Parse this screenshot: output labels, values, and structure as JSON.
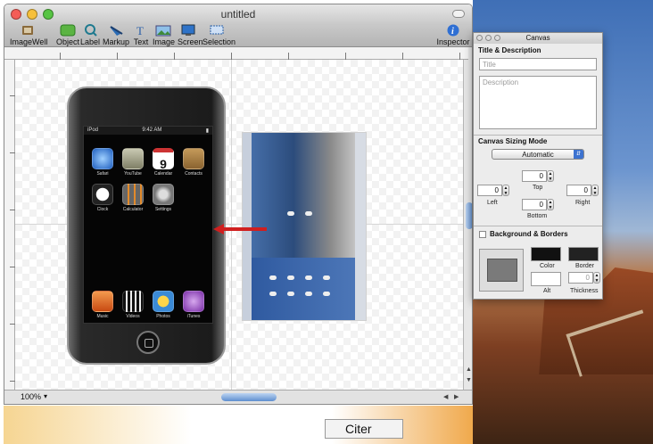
{
  "window": {
    "title": "untitled"
  },
  "toolbar": {
    "items": [
      {
        "label": "ImageWell",
        "icon": "imagewell-icon"
      },
      {
        "label": "Object",
        "icon": "object-icon"
      },
      {
        "label": "Label",
        "icon": "label-icon"
      },
      {
        "label": "Markup",
        "icon": "markup-icon"
      },
      {
        "label": "Text",
        "icon": "text-icon"
      },
      {
        "label": "Image",
        "icon": "image-icon"
      },
      {
        "label": "Screen",
        "icon": "screen-icon"
      },
      {
        "label": "Selection",
        "icon": "selection-icon"
      }
    ],
    "inspector": {
      "label": "Inspector",
      "icon": "info-icon"
    }
  },
  "ipod": {
    "carrier": "iPod",
    "time": "9:42 AM",
    "apps": [
      {
        "label": "Safari",
        "color": "#3b88e0"
      },
      {
        "label": "YouTube",
        "color": "#b9b9a0"
      },
      {
        "label": "Calendar",
        "color": "#ffffff",
        "date": "9"
      },
      {
        "label": "Contacts",
        "color": "#a27a43"
      },
      {
        "label": "Clock",
        "color": "#222222"
      },
      {
        "label": "Calculator",
        "color": "#555555"
      },
      {
        "label": "Settings",
        "color": "#8c8c8c"
      }
    ],
    "dock": [
      {
        "label": "Music",
        "color": "#e46b2b"
      },
      {
        "label": "Videos",
        "color": "#2b2b2b"
      },
      {
        "label": "Photos",
        "color": "#e6b52a"
      },
      {
        "label": "iTunes",
        "color": "#9b54c2"
      }
    ]
  },
  "status": {
    "zoom": "100%"
  },
  "below": {
    "citer_label": "Citer"
  },
  "panel": {
    "title": "Canvas",
    "title_section": "Title & Description",
    "title_placeholder": "Title",
    "description_placeholder": "Description",
    "sizing_section": "Canvas Sizing Mode",
    "sizing_mode": "Automatic",
    "margins": {
      "top": {
        "label": "Top",
        "value": "0"
      },
      "left": {
        "label": "Left",
        "value": "0"
      },
      "right": {
        "label": "Right",
        "value": "0"
      },
      "bottom": {
        "label": "Bottom",
        "value": "0"
      }
    },
    "background_section": "Background & Borders",
    "color_label": "Color",
    "border_label": "Border",
    "alt_label": "Alt",
    "thickness_label": "Thickness",
    "thickness_value": "0"
  }
}
